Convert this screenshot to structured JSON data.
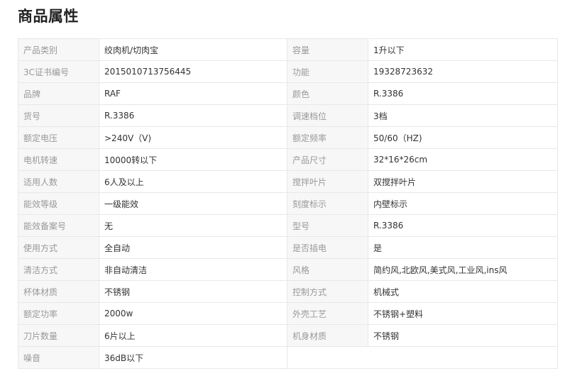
{
  "title": "商品属性",
  "rows": [
    [
      {
        "k": "产品类别",
        "v": "绞肉机/切肉宝"
      },
      {
        "k": "容量",
        "v": "1升以下"
      }
    ],
    [
      {
        "k": "3C证书编号",
        "v": "2015010713756445"
      },
      {
        "k": "功能",
        "v": "19328723632"
      }
    ],
    [
      {
        "k": "品牌",
        "v": "RAF"
      },
      {
        "k": "颜色",
        "v": "R.3386"
      }
    ],
    [
      {
        "k": "货号",
        "v": "R.3386"
      },
      {
        "k": "调速档位",
        "v": "3档"
      }
    ],
    [
      {
        "k": "额定电压",
        "v": ">240V（V)"
      },
      {
        "k": "额定频率",
        "v": "50/60（HZ)"
      }
    ],
    [
      {
        "k": "电机转速",
        "v": "10000转以下"
      },
      {
        "k": "产品尺寸",
        "v": "32*16*26cm"
      }
    ],
    [
      {
        "k": "适用人数",
        "v": "6人及以上"
      },
      {
        "k": "搅拌叶片",
        "v": "双搅拌叶片"
      }
    ],
    [
      {
        "k": "能效等级",
        "v": "一级能效"
      },
      {
        "k": "刻度标示",
        "v": "内壁标示"
      }
    ],
    [
      {
        "k": "能效备案号",
        "v": "无"
      },
      {
        "k": "型号",
        "v": "R.3386"
      }
    ],
    [
      {
        "k": "使用方式",
        "v": "全自动"
      },
      {
        "k": "是否插电",
        "v": "是"
      }
    ],
    [
      {
        "k": "清洁方式",
        "v": "非自动清洁"
      },
      {
        "k": "风格",
        "v": "简约风,北欧风,美式风,工业风,ins风"
      }
    ],
    [
      {
        "k": "杯体材质",
        "v": "不锈钢"
      },
      {
        "k": "控制方式",
        "v": "机械式"
      }
    ],
    [
      {
        "k": "额定功率",
        "v": "2000w"
      },
      {
        "k": "外壳工艺",
        "v": "不锈钢+塑料"
      }
    ],
    [
      {
        "k": "刀片数量",
        "v": "6片以上"
      },
      {
        "k": "机身材质",
        "v": "不锈钢"
      }
    ],
    [
      {
        "k": "噪音",
        "v": "36dB以下"
      }
    ]
  ]
}
